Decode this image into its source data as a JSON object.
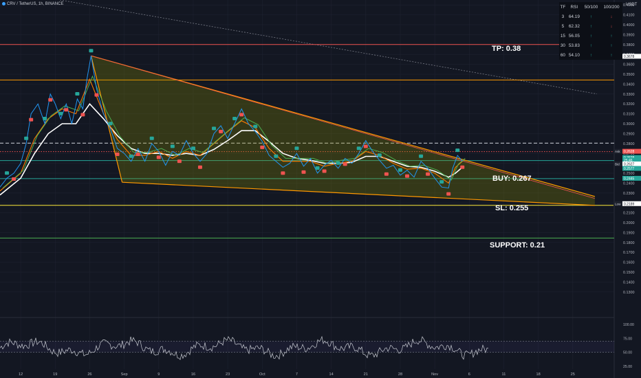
{
  "header": {
    "symbol_line": "CRV / TetherUS, 1h, BINANCE",
    "currency": "USDT"
  },
  "rsi_table": {
    "headers": [
      "TF",
      "RSI",
      "50/100",
      "100/200"
    ],
    "rows": [
      {
        "tf": "3",
        "rsi": "64.19",
        "a": "↑",
        "b": "↓",
        "a_color": "#26a69a",
        "b_color": "#ef5350"
      },
      {
        "tf": "5",
        "rsi": "62.32",
        "a": "↑",
        "b": "↓",
        "a_color": "#26a69a",
        "b_color": "#ef5350"
      },
      {
        "tf": "15",
        "rsi": "56.05",
        "a": "↑",
        "b": "↑",
        "a_color": "#26a69a",
        "b_color": "#26a69a"
      },
      {
        "tf": "30",
        "rsi": "53.83",
        "a": "↑",
        "b": "↑",
        "a_color": "#26a69a",
        "b_color": "#26a69a"
      },
      {
        "tf": "60",
        "rsi": "54.10",
        "a": "↑",
        "b": "↑",
        "a_color": "#26a69a",
        "b_color": "#26a69a"
      }
    ]
  },
  "annotations": {
    "tp": "TP: 0.38",
    "buy": "BUY: 0.267",
    "sl": "SL: 0.255",
    "support": "SUPPORT: 0.21"
  },
  "chart_data": {
    "type": "line",
    "y_axis": {
      "ticks": [
        "0.4200",
        "0.4100",
        "0.4000",
        "0.3900",
        "0.3800",
        "0.3700",
        "0.3600",
        "0.3500",
        "0.3400",
        "0.3300",
        "0.3200",
        "0.3100",
        "0.3000",
        "0.2900",
        "0.2800",
        "0.2700",
        "0.2600",
        "0.2500",
        "0.2400",
        "0.2300",
        "0.2200",
        "0.2100",
        "0.2000",
        "0.1900",
        "0.1800",
        "0.1700",
        "0.1600",
        "0.1500",
        "0.1400",
        "0.1300"
      ],
      "range": [
        0.125,
        0.425
      ]
    },
    "x_axis": {
      "labels": [
        "12",
        "19",
        "26",
        "Sep",
        "9",
        "16",
        "23",
        "Oct",
        "7",
        "14",
        "21",
        "28",
        "Nov",
        "6",
        "11",
        "18",
        "25"
      ],
      "units": [
        0,
        5,
        10,
        15,
        20,
        25,
        30,
        35,
        40,
        45,
        50,
        55,
        60,
        65,
        70,
        75,
        80
      ],
      "range": [
        -3,
        86
      ]
    },
    "price_tags": [
      {
        "label": "High",
        "value": "0.3678",
        "y": 0.3678,
        "bg": "#ffffff",
        "fg": "#131722"
      },
      {
        "label": "Ask",
        "value": "0.2628",
        "y": 0.2718,
        "bg": "#ef5350",
        "fg": "#ffffff"
      },
      {
        "label": "",
        "value": "0.2628",
        "y": 0.2655,
        "bg": "#26a69a",
        "fg": "#ffffff"
      },
      {
        "label": "",
        "value": "25:46",
        "y": 0.2628,
        "bg": "#26a69a",
        "fg": "#ffffff"
      },
      {
        "label": "Bid",
        "value": "0.2627",
        "y": 0.259,
        "bg": "#ffffff",
        "fg": "#131722"
      },
      {
        "label": "",
        "value": "0.2577",
        "y": 0.2545,
        "bg": "#26a69a",
        "fg": "#ffffff"
      },
      {
        "label": "",
        "value": "0.2445",
        "y": 0.2445,
        "bg": "#26a69a",
        "fg": "#ffffff"
      },
      {
        "label": "Low",
        "value": "0.2189",
        "y": 0.2189,
        "bg": "#ffffff",
        "fg": "#131722"
      }
    ],
    "levels": [
      {
        "y": 0.38,
        "color": "#ef5350",
        "style": "solid"
      },
      {
        "y": 0.3442,
        "color": "#ff9800",
        "style": "solid"
      },
      {
        "y": 0.2804,
        "color": "#d1d4dc",
        "style": "dashed"
      },
      {
        "y": 0.2718,
        "color": "#ef5350",
        "style": "dotted"
      },
      {
        "y": 0.2628,
        "color": "#26a69a",
        "style": "solid"
      },
      {
        "y": 0.2445,
        "color": "#26a69a",
        "style": "solid"
      },
      {
        "y": 0.2175,
        "color": "#ffeb3b",
        "style": "solid"
      },
      {
        "y": 0.1845,
        "color": "#4caf50",
        "style": "solid"
      }
    ],
    "wedge": {
      "upper": [
        [
          10.2,
          0.3686
        ],
        [
          83.2,
          0.2265
        ]
      ],
      "lower": [
        [
          14.7,
          0.2408
        ],
        [
          83.2,
          0.2175
        ]
      ],
      "left": [
        [
          10.2,
          0.3686
        ],
        [
          14.7,
          0.2408
        ]
      ],
      "inner_line": [
        [
          10.2,
          0.3686
        ],
        [
          83.2,
          0.2265
        ]
      ]
    },
    "downtrend": [
      [
        4.5,
        0.4265
      ],
      [
        83.5,
        0.3301
      ]
    ],
    "price": [
      [
        -3,
        0.236
      ],
      [
        -2,
        0.245
      ],
      [
        -1,
        0.25
      ],
      [
        0,
        0.26
      ],
      [
        0.8,
        0.28
      ],
      [
        1.5,
        0.31
      ],
      [
        2.5,
        0.32
      ],
      [
        3.5,
        0.3
      ],
      [
        4.3,
        0.33
      ],
      [
        5,
        0.32
      ],
      [
        5.8,
        0.305
      ],
      [
        6.6,
        0.32
      ],
      [
        7.4,
        0.3
      ],
      [
        8.2,
        0.325
      ],
      [
        9,
        0.315
      ],
      [
        9.6,
        0.345
      ],
      [
        10.2,
        0.3686
      ],
      [
        11,
        0.335
      ],
      [
        12,
        0.31
      ],
      [
        13,
        0.295
      ],
      [
        14,
        0.275
      ],
      [
        15,
        0.27
      ],
      [
        16,
        0.262
      ],
      [
        17,
        0.275
      ],
      [
        18,
        0.262
      ],
      [
        19,
        0.28
      ],
      [
        20,
        0.272
      ],
      [
        21,
        0.258
      ],
      [
        22,
        0.272
      ],
      [
        23,
        0.268
      ],
      [
        24,
        0.283
      ],
      [
        25,
        0.27
      ],
      [
        26,
        0.262
      ],
      [
        27,
        0.27
      ],
      [
        28,
        0.29
      ],
      [
        29,
        0.298
      ],
      [
        30,
        0.285
      ],
      [
        31,
        0.3
      ],
      [
        32,
        0.315
      ],
      [
        33,
        0.3
      ],
      [
        34,
        0.292
      ],
      [
        35,
        0.282
      ],
      [
        36,
        0.268
      ],
      [
        37,
        0.262
      ],
      [
        38,
        0.256
      ],
      [
        39,
        0.26
      ],
      [
        40,
        0.27
      ],
      [
        41,
        0.257
      ],
      [
        42,
        0.265
      ],
      [
        43,
        0.25
      ],
      [
        44,
        0.258
      ],
      [
        45,
        0.263
      ],
      [
        46,
        0.255
      ],
      [
        47,
        0.265
      ],
      [
        48,
        0.26
      ],
      [
        49,
        0.27
      ],
      [
        50,
        0.283
      ],
      [
        51,
        0.272
      ],
      [
        52,
        0.263
      ],
      [
        53,
        0.255
      ],
      [
        54,
        0.258
      ],
      [
        55,
        0.248
      ],
      [
        56,
        0.253
      ],
      [
        57,
        0.246
      ],
      [
        58,
        0.262
      ],
      [
        59,
        0.255
      ],
      [
        60,
        0.245
      ],
      [
        61,
        0.236
      ],
      [
        62,
        0.235
      ],
      [
        62.6,
        0.255
      ],
      [
        63.3,
        0.268
      ],
      [
        64,
        0.262
      ]
    ],
    "ma_fast": [
      [
        -3,
        0.232
      ],
      [
        0,
        0.25
      ],
      [
        2,
        0.285
      ],
      [
        4,
        0.305
      ],
      [
        6,
        0.315
      ],
      [
        8,
        0.31
      ],
      [
        10,
        0.345
      ],
      [
        12,
        0.31
      ],
      [
        14,
        0.284
      ],
      [
        16,
        0.268
      ],
      [
        18,
        0.268
      ],
      [
        20,
        0.272
      ],
      [
        22,
        0.265
      ],
      [
        24,
        0.272
      ],
      [
        26,
        0.268
      ],
      [
        28,
        0.28
      ],
      [
        30,
        0.292
      ],
      [
        32,
        0.303
      ],
      [
        34,
        0.296
      ],
      [
        36,
        0.275
      ],
      [
        38,
        0.262
      ],
      [
        40,
        0.262
      ],
      [
        42,
        0.262
      ],
      [
        44,
        0.257
      ],
      [
        46,
        0.26
      ],
      [
        48,
        0.262
      ],
      [
        50,
        0.272
      ],
      [
        52,
        0.268
      ],
      [
        54,
        0.26
      ],
      [
        56,
        0.254
      ],
      [
        58,
        0.255
      ],
      [
        60,
        0.25
      ],
      [
        62,
        0.24
      ],
      [
        63,
        0.256
      ],
      [
        64,
        0.262
      ]
    ],
    "ma_slow": [
      [
        -3,
        0.228
      ],
      [
        0,
        0.245
      ],
      [
        2,
        0.27
      ],
      [
        4,
        0.29
      ],
      [
        6,
        0.3
      ],
      [
        8,
        0.3
      ],
      [
        10,
        0.32
      ],
      [
        12,
        0.305
      ],
      [
        14,
        0.288
      ],
      [
        16,
        0.275
      ],
      [
        18,
        0.27
      ],
      [
        20,
        0.27
      ],
      [
        22,
        0.268
      ],
      [
        24,
        0.27
      ],
      [
        26,
        0.268
      ],
      [
        28,
        0.274
      ],
      [
        30,
        0.283
      ],
      [
        32,
        0.293
      ],
      [
        34,
        0.293
      ],
      [
        36,
        0.282
      ],
      [
        38,
        0.27
      ],
      [
        40,
        0.265
      ],
      [
        42,
        0.263
      ],
      [
        44,
        0.26
      ],
      [
        46,
        0.26
      ],
      [
        48,
        0.261
      ],
      [
        50,
        0.267
      ],
      [
        52,
        0.267
      ],
      [
        54,
        0.262
      ],
      [
        56,
        0.257
      ],
      [
        58,
        0.256
      ],
      [
        60,
        0.252
      ],
      [
        62,
        0.246
      ],
      [
        63,
        0.25
      ],
      [
        64,
        0.256
      ]
    ],
    "indicator": {
      "ticks": [
        "100.00",
        "75.00",
        "50.00",
        "25.00"
      ],
      "range": [
        20,
        105
      ],
      "overbought": 70,
      "oversold": 50
    }
  },
  "colors": {
    "background": "#131722",
    "grid": "#1e2230",
    "price": "#2196f3",
    "bull": "#26a69a",
    "bear": "#ef5350",
    "wedge": "#ff9800"
  }
}
